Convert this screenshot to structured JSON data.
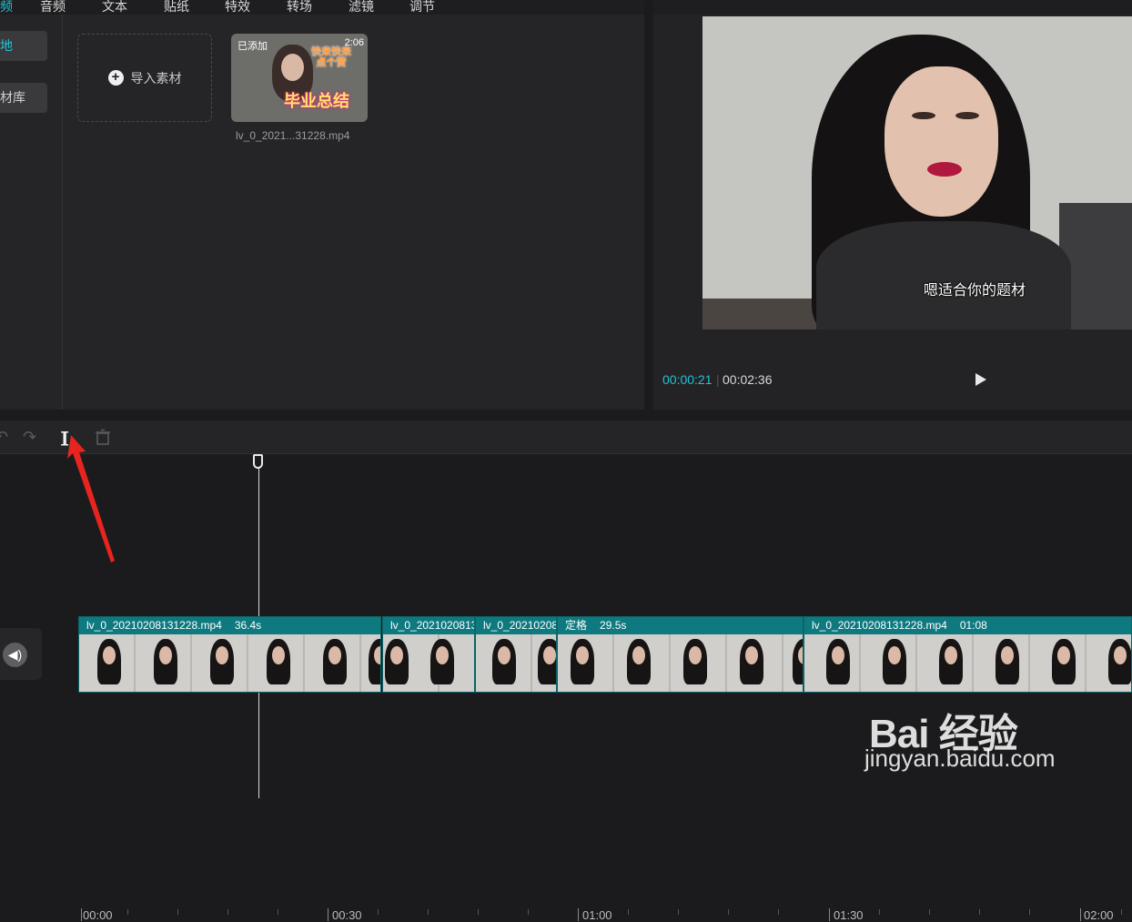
{
  "tabs": [
    {
      "label": "频",
      "active": true
    },
    {
      "label": "音频"
    },
    {
      "label": "文本"
    },
    {
      "label": "贴纸"
    },
    {
      "label": "特效"
    },
    {
      "label": "转场"
    },
    {
      "label": "滤镜"
    },
    {
      "label": "调节"
    }
  ],
  "sidebar": {
    "local_label": "地",
    "library_label": "材库"
  },
  "media": {
    "import_label": "导入素材",
    "thumb_added": "已添加",
    "thumb_duration": "2:06",
    "thumb_top_text": "快来快来 点个赞",
    "thumb_title": "毕业总结",
    "file_name": "lv_0_2021...31228.mp4"
  },
  "player": {
    "subtitle": "嗯适合你的题材",
    "current_time": "00:00:21",
    "separator": "|",
    "total_time": "00:02:36"
  },
  "ruler": {
    "labels": [
      "00:00",
      "00:30",
      "01:00",
      "01:30",
      "02:00"
    ]
  },
  "clips": [
    {
      "name": "lv_0_20210208131228.mp4",
      "duration": "36.4s"
    },
    {
      "name": "lv_0_2021020813",
      "duration": ""
    },
    {
      "name": "lv_0_20210208",
      "duration": ""
    },
    {
      "name": "定格",
      "duration": "29.5s"
    },
    {
      "name": "lv_0_20210208131228.mp4",
      "duration": "01:08"
    }
  ],
  "watermark": {
    "main": "Bai 经验",
    "sub": "jingyan.baidu.com"
  },
  "colors": {
    "accent": "#1fc3d6",
    "clip": "#0e7a80",
    "arrow": "#e8241e"
  }
}
